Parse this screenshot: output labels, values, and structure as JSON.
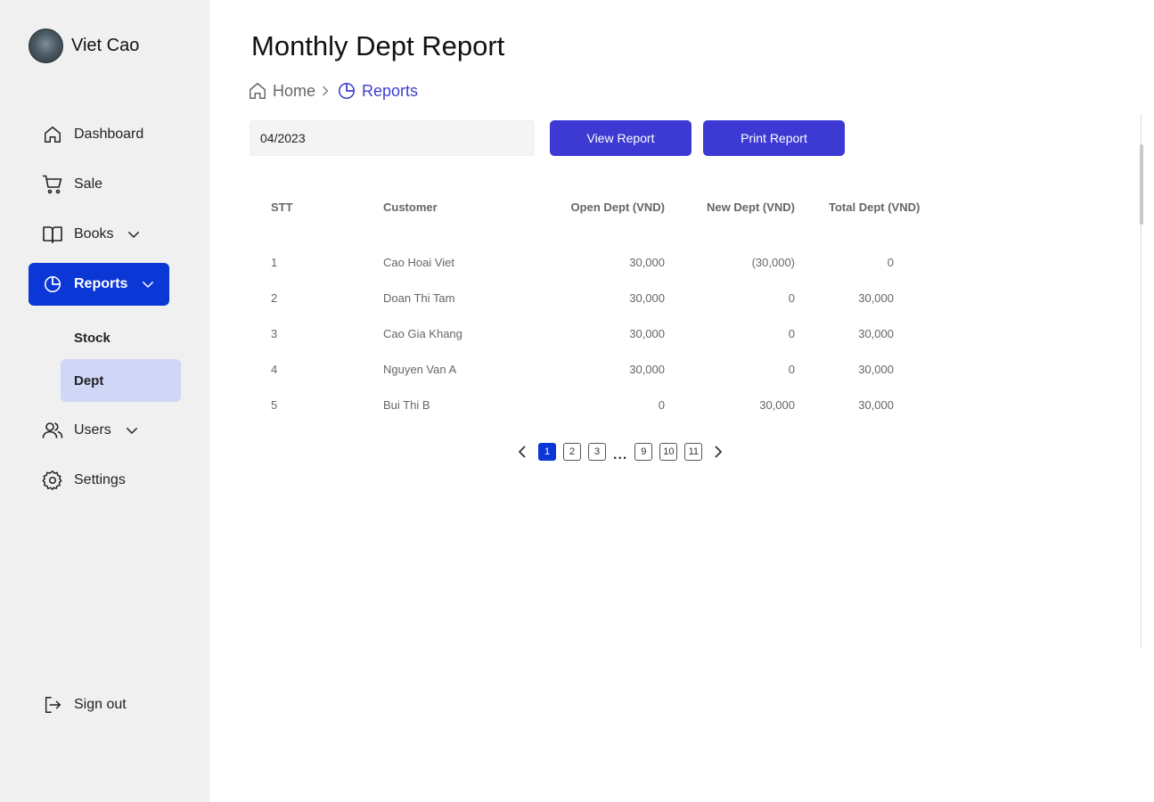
{
  "profile": {
    "name": "Viet Cao"
  },
  "sidebar": {
    "items": [
      {
        "label": "Dashboard",
        "icon": "home-icon"
      },
      {
        "label": "Sale",
        "icon": "cart-icon"
      },
      {
        "label": "Books",
        "icon": "book-icon",
        "expandable": true
      },
      {
        "label": "Reports",
        "icon": "pie-chart-icon",
        "expandable": true,
        "active": true
      },
      {
        "label": "Users",
        "icon": "users-icon",
        "expandable": true
      },
      {
        "label": "Settings",
        "icon": "gear-icon"
      }
    ],
    "reports_sub": [
      {
        "label": "Stock"
      },
      {
        "label": "Dept",
        "selected": true
      }
    ],
    "signout_label": "Sign out"
  },
  "page": {
    "title": "Monthly Dept Report"
  },
  "breadcrumb": {
    "home": "Home",
    "current": "Reports"
  },
  "filter": {
    "period_value": "04/2023"
  },
  "actions": {
    "view_label": "View Report",
    "print_label": "Print Report"
  },
  "table": {
    "headers": [
      "STT",
      "Customer",
      "Open Dept (VND)",
      "New Dept (VND)",
      "Total Dept (VND)"
    ],
    "rows": [
      [
        "1",
        "Cao Hoai Viet",
        "30,000",
        "(30,000)",
        "0"
      ],
      [
        "2",
        "Doan Thi Tam",
        "30,000",
        "0",
        "30,000"
      ],
      [
        "3",
        "Cao Gia Khang",
        "30,000",
        "0",
        "30,000"
      ],
      [
        "4",
        "Nguyen Van A",
        "30,000",
        "0",
        "30,000"
      ],
      [
        "5",
        "Bui Thi B",
        "0",
        "30,000",
        "30,000"
      ]
    ]
  },
  "pagination": {
    "pages_before": [
      "1",
      "2",
      "3"
    ],
    "ellipsis": "...",
    "pages_after": [
      "9",
      "10",
      "11"
    ],
    "current": "1"
  },
  "colors": {
    "accent": "#0b37d6",
    "button": "#3c3ad3",
    "sidebar_bg": "#f0f0f0",
    "selected_sub_bg": "#cfd6f6",
    "breadcrumb_current": "#3f3fd0"
  }
}
